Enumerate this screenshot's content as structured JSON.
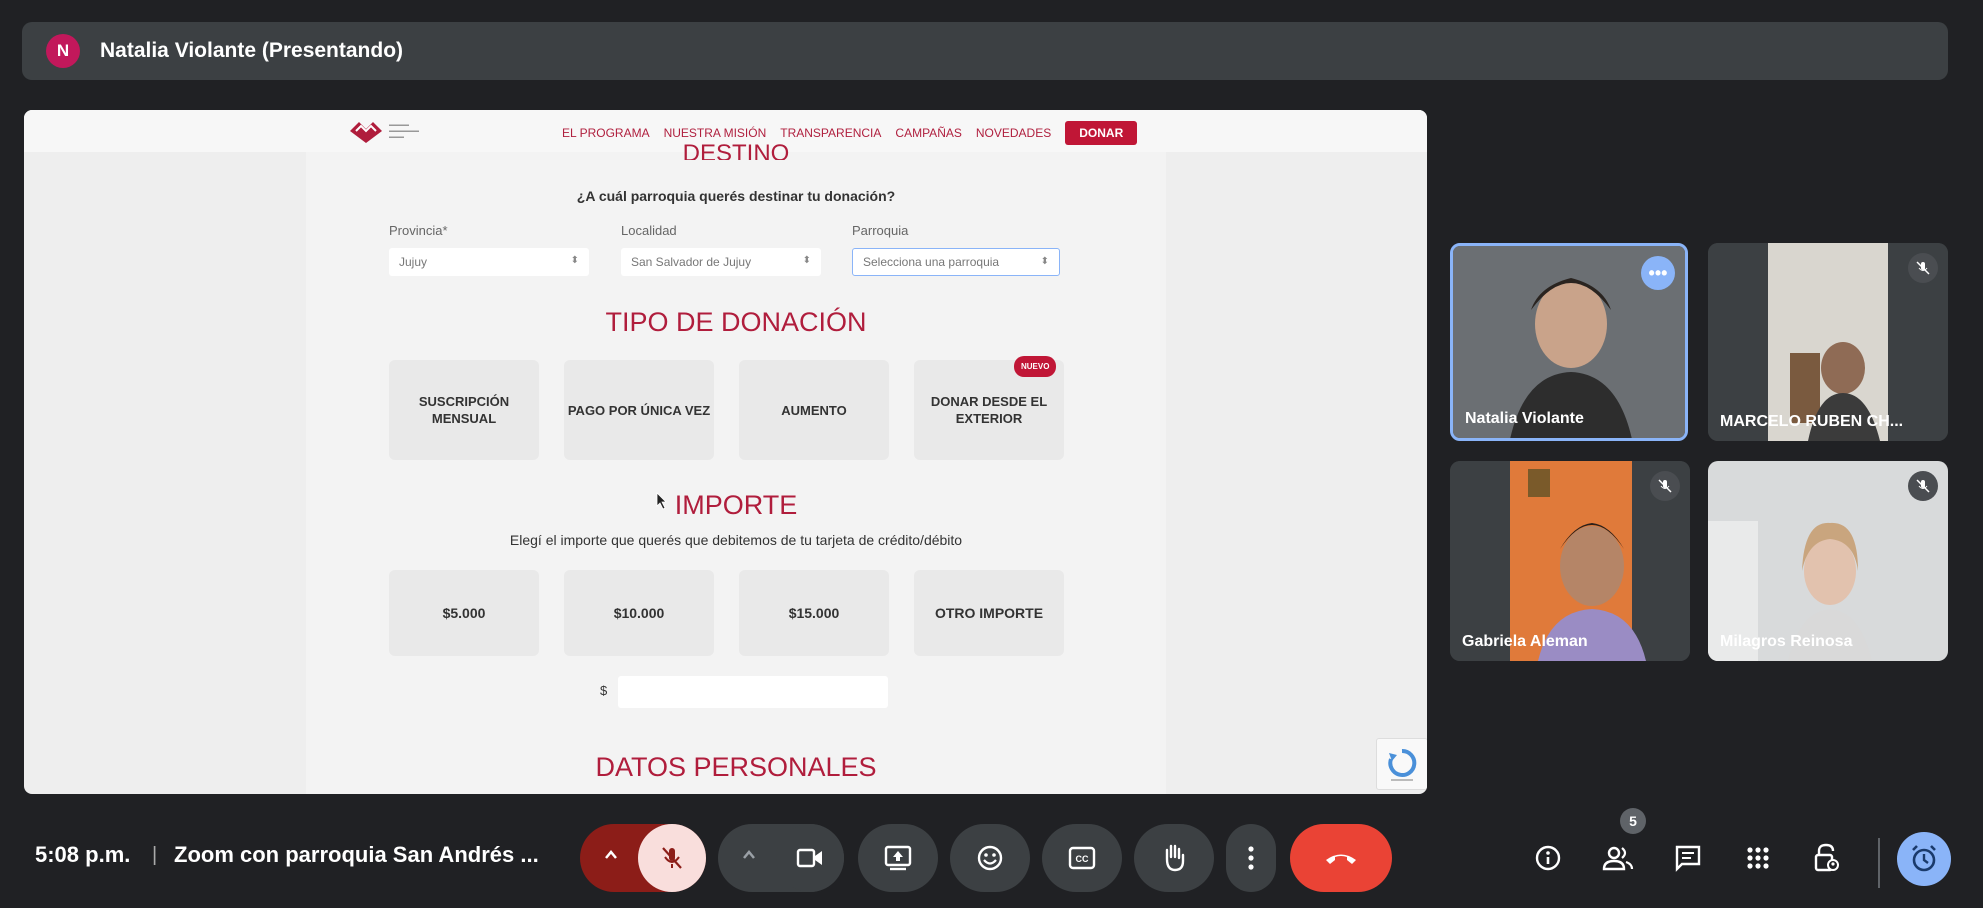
{
  "meet": {
    "presenter_initial": "N",
    "presenter_label": "Natalia Violante (Presentando)",
    "time": "5:08 p.m.",
    "separator": "|",
    "meeting_name": "Zoom con parroquia San Andrés ...",
    "participants_count": "5",
    "accent_color": "#8ab4f8",
    "hangup_color": "#ea4335"
  },
  "site": {
    "nav": [
      "EL PROGRAMA",
      "NUESTRA MISIÓN",
      "TRANSPARENCIA",
      "CAMPAÑAS",
      "NOVEDADES"
    ],
    "donate_label": "DONAR",
    "brand_color": "#b01d3c",
    "destino_title": "DESTINO",
    "destino_question": "¿A cuál parroquia querés destinar tu donación?",
    "provincia_label": "Provincia*",
    "provincia_value": "Jujuy",
    "localidad_label": "Localidad",
    "localidad_value": "San Salvador de Jujuy",
    "parroquia_label": "Parroquia",
    "parroquia_value": "Selecciona una parroquia",
    "tipo_title": "TIPO DE DONACIÓN",
    "tipo_cards": [
      "SUSCRIPCIÓN MENSUAL",
      "PAGO POR ÚNICA VEZ",
      "AUMENTO",
      "DONAR DESDE EL EXTERIOR"
    ],
    "nuevo_badge": "NUEVO",
    "importe_title": "IMPORTE",
    "importe_sub": "Elegí el importe que querés que debitemos de tu tarjeta de crédito/débito",
    "amounts": [
      "$5.000",
      "$10.000",
      "$15.000",
      "OTRO IMPORTE"
    ],
    "currency_symbol": "$",
    "datos_title": "DATOS PERSONALES"
  },
  "participants": [
    {
      "name": "Natalia Violante"
    },
    {
      "name": "MARCELO RUBEN CH..."
    },
    {
      "name": "Gabriela Aleman"
    },
    {
      "name": "Milagros Reinosa"
    }
  ]
}
